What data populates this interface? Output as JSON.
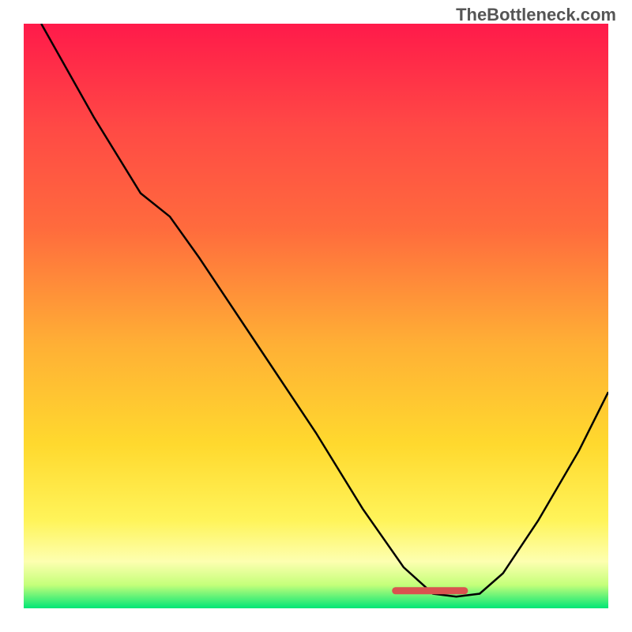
{
  "watermark": "TheBottleneck.com",
  "chart_data": {
    "type": "line",
    "title": "",
    "xlabel": "",
    "ylabel": "",
    "xlim": [
      0,
      100
    ],
    "ylim": [
      0,
      100
    ],
    "gradient_colors": {
      "top": "#ff1a4a",
      "mid1": "#ff6b3d",
      "mid2": "#ffb035",
      "mid3": "#ffd92e",
      "mid4": "#fff45a",
      "mid5": "#fdffb0",
      "mid6": "#c5ff7a",
      "bottom": "#00e676"
    },
    "curve": [
      {
        "x": 3,
        "y": 100
      },
      {
        "x": 12,
        "y": 84
      },
      {
        "x": 20,
        "y": 71
      },
      {
        "x": 25,
        "y": 67
      },
      {
        "x": 30,
        "y": 60
      },
      {
        "x": 40,
        "y": 45
      },
      {
        "x": 50,
        "y": 30
      },
      {
        "x": 58,
        "y": 17
      },
      {
        "x": 65,
        "y": 7
      },
      {
        "x": 70,
        "y": 2.5
      },
      {
        "x": 74,
        "y": 2
      },
      {
        "x": 78,
        "y": 2.5
      },
      {
        "x": 82,
        "y": 6
      },
      {
        "x": 88,
        "y": 15
      },
      {
        "x": 95,
        "y": 27
      },
      {
        "x": 100,
        "y": 37
      }
    ],
    "marker": {
      "x_start": 63,
      "x_end": 76,
      "y": 3,
      "color": "#d9534f"
    }
  }
}
